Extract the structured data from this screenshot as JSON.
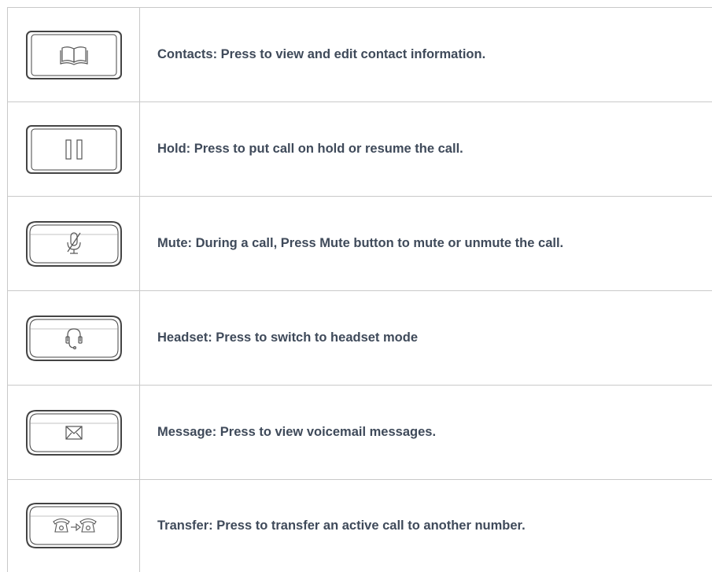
{
  "rows": [
    {
      "icon": "contacts-icon",
      "label": "Contacts: Press to view and edit contact information."
    },
    {
      "icon": "hold-icon",
      "label": "Hold: Press to put call on hold or resume the call."
    },
    {
      "icon": "mute-icon",
      "label": "Mute: During a call, Press Mute button to mute or unmute the call."
    },
    {
      "icon": "headset-icon",
      "label": "Headset: Press to switch to headset mode"
    },
    {
      "icon": "message-icon",
      "label": "Message: Press to view voicemail messages."
    },
    {
      "icon": "transfer-icon",
      "label": "Transfer: Press to transfer an active call to another number."
    }
  ],
  "colors": {
    "text": "#3f4a5a",
    "border": "#c9c9c9",
    "key_outline": "#444444"
  }
}
